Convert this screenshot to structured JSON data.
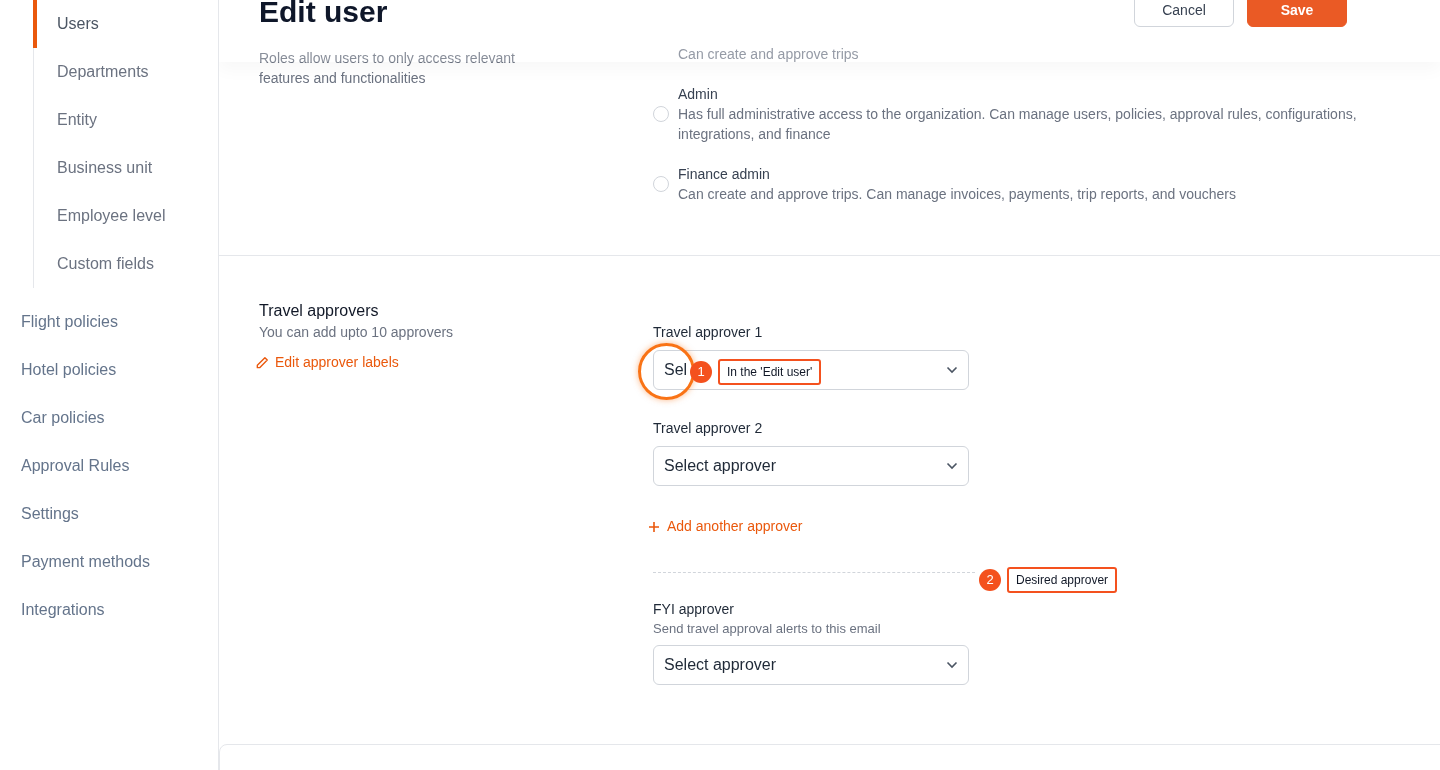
{
  "sidebar": {
    "sub_items": [
      {
        "label": "Users",
        "selected": true
      },
      {
        "label": "Departments",
        "selected": false
      },
      {
        "label": "Entity",
        "selected": false
      },
      {
        "label": "Business unit",
        "selected": false
      },
      {
        "label": "Employee level",
        "selected": false
      },
      {
        "label": "Custom fields",
        "selected": false
      }
    ],
    "items": [
      {
        "label": "Flight policies",
        "selected": false
      },
      {
        "label": "Hotel policies",
        "selected": false
      },
      {
        "label": "Car policies",
        "selected": false
      },
      {
        "label": "Approval Rules",
        "selected": false
      },
      {
        "label": "Settings",
        "selected": false
      },
      {
        "label": "Payment methods",
        "selected": false
      },
      {
        "label": "Integrations",
        "selected": false
      }
    ]
  },
  "header": {
    "title": "Edit user",
    "buttons": [
      {
        "label": "Cancel",
        "kind": "secondary"
      },
      {
        "label": "Save",
        "kind": "primary"
      }
    ]
  },
  "roles": {
    "description": "Roles allow users to only access relevant features and functionalities",
    "options": [
      {
        "description": "Can create and approve trips"
      },
      {
        "title": "Admin",
        "description": "Has full administrative access to the organization. Can manage users, policies, approval rules, configurations, integrations, and finance",
        "selected": false
      },
      {
        "title": "Finance admin",
        "description": "Can create and approve trips. Can manage invoices, payments, trip reports, and vouchers",
        "selected": false
      }
    ]
  },
  "travel_approvers": {
    "title": "Travel approvers",
    "description": "You can add upto 10 approvers",
    "edit_link": "Edit approver labels",
    "fields": [
      {
        "label": "Travel approver 1",
        "placeholder": "Sel"
      },
      {
        "label": "Travel approver 2",
        "placeholder": "Select approver"
      }
    ],
    "add_link": "Add another approver",
    "fyi": {
      "label": "FYI approver",
      "description": "Send travel approval alerts to this email",
      "placeholder": "Select approver"
    }
  },
  "annotations": [
    {
      "number": "1",
      "text": "In the 'Edit user'"
    },
    {
      "number": "2",
      "text": "Desired approver"
    }
  ]
}
